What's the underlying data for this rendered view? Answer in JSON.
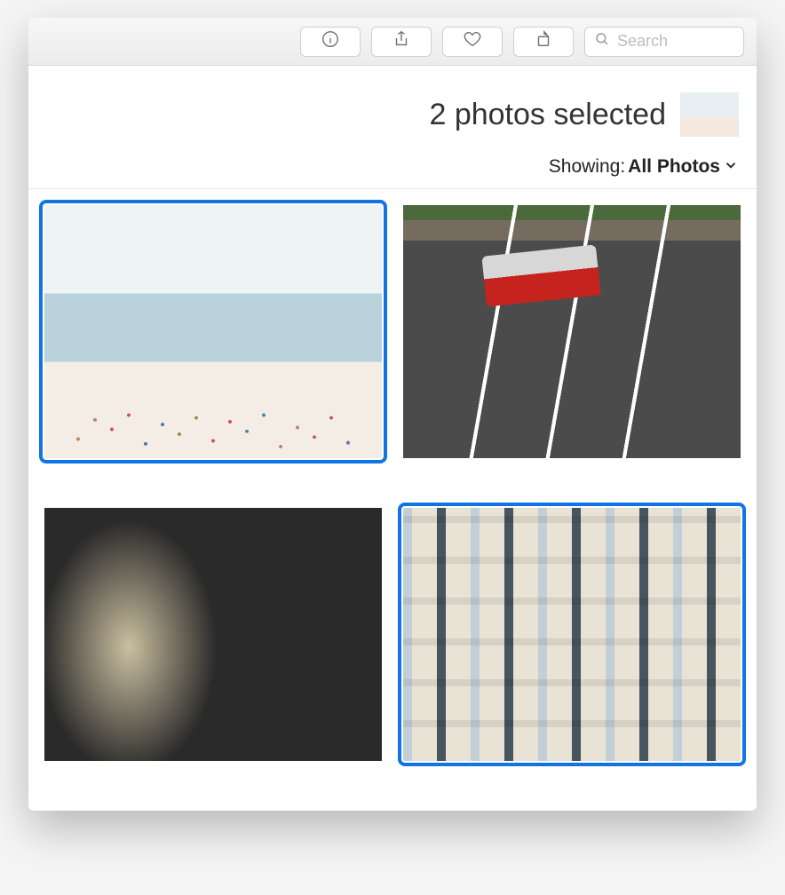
{
  "toolbar": {
    "buttons": [
      {
        "name": "info-button",
        "icon": "info-icon"
      },
      {
        "name": "share-button",
        "icon": "share-icon"
      },
      {
        "name": "favorite-button",
        "icon": "heart-icon"
      },
      {
        "name": "rotate-button",
        "icon": "rotate-icon"
      }
    ],
    "search": {
      "placeholder": "Search",
      "value": ""
    }
  },
  "header": {
    "selection_text": "2 photos selected",
    "filter_label": "Showing: ",
    "filter_value": "All Photos"
  },
  "photos": [
    {
      "name": "photo-beach",
      "selected": true
    },
    {
      "name": "photo-taxi",
      "selected": false
    },
    {
      "name": "photo-chrome",
      "selected": false
    },
    {
      "name": "photo-building",
      "selected": true
    }
  ]
}
